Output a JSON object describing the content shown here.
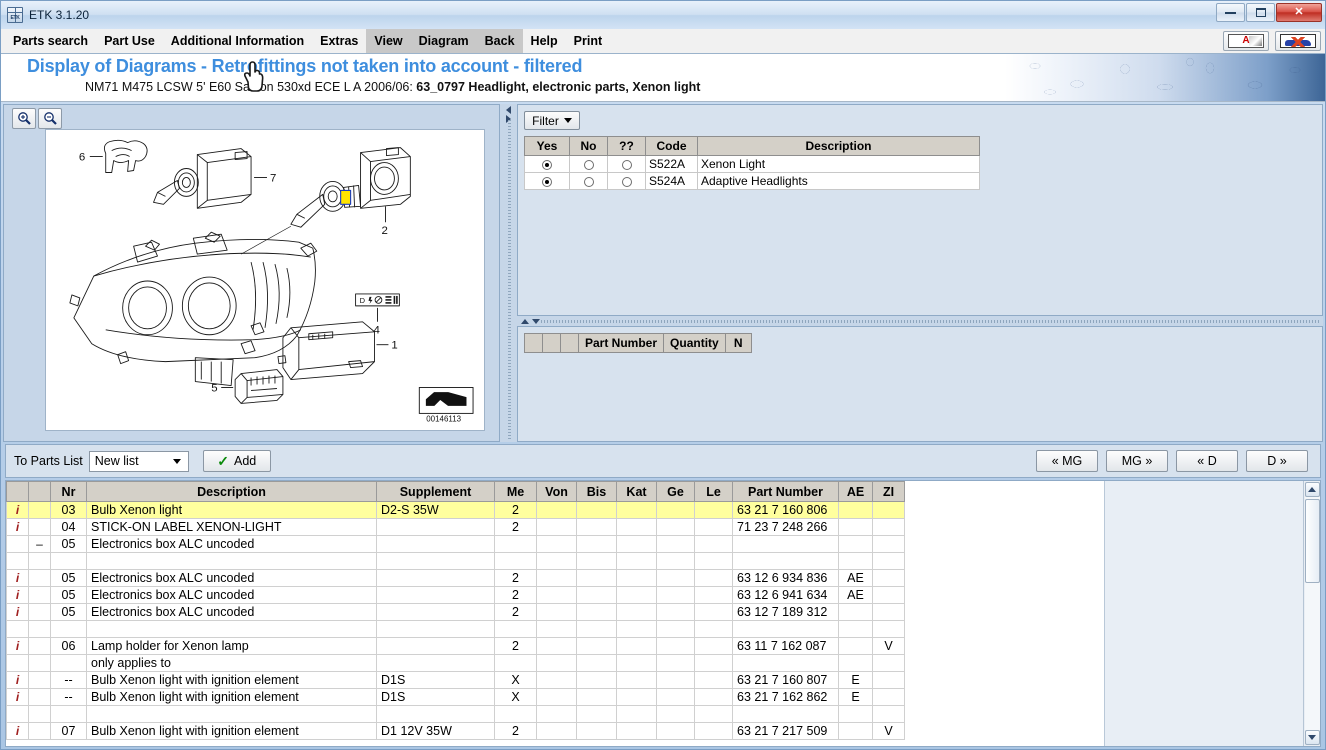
{
  "window": {
    "title": "ETK 3.1.20",
    "icon": "etk-app-icon",
    "minimize_label": "Minimize",
    "maximize_label": "Maximize",
    "close_label": "✕"
  },
  "menubar": {
    "items": [
      {
        "label": "Parts search",
        "highlighted": false
      },
      {
        "label": "Part Use",
        "highlighted": false
      },
      {
        "label": "Additional Information",
        "highlighted": false
      },
      {
        "label": "Extras",
        "highlighted": false
      },
      {
        "label": "View",
        "highlighted": true
      },
      {
        "label": "Diagram",
        "highlighted": true
      },
      {
        "label": "Back",
        "highlighted": true
      },
      {
        "label": "Help",
        "highlighted": false
      },
      {
        "label": "Print",
        "highlighted": false
      }
    ],
    "tools": [
      {
        "name": "alphabet-index-icon",
        "glyph": "A"
      },
      {
        "name": "vehicle-icon",
        "glyph": "car"
      }
    ]
  },
  "banner": {
    "title": "Display of Diagrams - Retrofittings not taken into account - filtered",
    "subtitle_prefix": "NM71 M475 LCSW 5' E60 Saloon 530xd ECE L A 2006/06: ",
    "subtitle_bold": "63_0797 Headlight, electronic parts, Xenon light",
    "title_color": "#3e8ede"
  },
  "diagram": {
    "zoom_in_label": "Zoom in",
    "zoom_out_label": "Zoom out",
    "image_id": "00146113",
    "callouts": [
      "1",
      "2",
      "4",
      "5",
      "6",
      "7"
    ],
    "label_icon_text": "D"
  },
  "filter": {
    "button_label": "Filter",
    "columns": [
      "Yes",
      "No",
      "??",
      "Code",
      "Description"
    ],
    "rows": [
      {
        "yes": true,
        "no": false,
        "unknown": false,
        "code": "S522A",
        "description": "Xenon Light"
      },
      {
        "yes": true,
        "no": false,
        "unknown": false,
        "code": "S524A",
        "description": "Adaptive Headlights"
      }
    ]
  },
  "selected_parts": {
    "columns": [
      "",
      "",
      "",
      "Part Number",
      "Quantity",
      "N"
    ],
    "rows": []
  },
  "actionbar": {
    "to_parts_list_label": "To Parts List",
    "list_value": "New list",
    "add_label": "Add",
    "nav": [
      {
        "label": "« MG",
        "name": "prev-main-group-button"
      },
      {
        "label": "MG »",
        "name": "next-main-group-button"
      },
      {
        "label": "« D",
        "name": "prev-diagram-button"
      },
      {
        "label": "D »",
        "name": "next-diagram-button"
      }
    ]
  },
  "parts_grid": {
    "columns": [
      "",
      "",
      "Nr",
      "Description",
      "Supplement",
      "Me",
      "Von",
      "Bis",
      "Kat",
      "Ge",
      "Le",
      "Part Number",
      "AE",
      "ZI"
    ],
    "rows": [
      {
        "info": "i",
        "exp": "",
        "nr": "03",
        "description": "Bulb Xenon light",
        "supplement": "D2-S 35W",
        "me": "2",
        "von": "",
        "bis": "",
        "kat": "",
        "ge": "",
        "le": "",
        "part_number": "63 21 7 160 806",
        "ae": "",
        "zi": "",
        "highlighted": true
      },
      {
        "info": "i",
        "exp": "",
        "nr": "04",
        "description": "STICK-ON LABEL XENON-LIGHT",
        "supplement": "",
        "me": "2",
        "von": "",
        "bis": "",
        "kat": "",
        "ge": "",
        "le": "",
        "part_number": "71 23 7 248 266",
        "ae": "",
        "zi": "",
        "highlighted": false
      },
      {
        "info": "",
        "exp": "–",
        "nr": "05",
        "description": "Electronics box ALC uncoded",
        "supplement": "",
        "me": "",
        "von": "",
        "bis": "",
        "kat": "",
        "ge": "",
        "le": "",
        "part_number": "",
        "ae": "",
        "zi": "",
        "highlighted": false
      },
      {
        "info": "",
        "exp": "",
        "nr": "",
        "description": "",
        "supplement": "",
        "me": "",
        "von": "",
        "bis": "",
        "kat": "",
        "ge": "",
        "le": "",
        "part_number": "",
        "ae": "",
        "zi": "",
        "highlighted": false
      },
      {
        "info": "i",
        "exp": "",
        "nr": "05",
        "description": "Electronics box ALC uncoded",
        "supplement": "",
        "me": "2",
        "von": "",
        "bis": "",
        "kat": "",
        "ge": "",
        "le": "",
        "part_number": "63 12 6 934 836",
        "ae": "AE",
        "zi": "",
        "highlighted": false
      },
      {
        "info": "i",
        "exp": "",
        "nr": "05",
        "description": "Electronics box ALC uncoded",
        "supplement": "",
        "me": "2",
        "von": "",
        "bis": "",
        "kat": "",
        "ge": "",
        "le": "",
        "part_number": "63 12 6 941 634",
        "ae": "AE",
        "zi": "",
        "highlighted": false
      },
      {
        "info": "i",
        "exp": "",
        "nr": "05",
        "description": "Electronics box ALC uncoded",
        "supplement": "",
        "me": "2",
        "von": "",
        "bis": "",
        "kat": "",
        "ge": "",
        "le": "",
        "part_number": "63 12 7 189 312",
        "ae": "",
        "zi": "",
        "highlighted": false
      },
      {
        "info": "",
        "exp": "",
        "nr": "",
        "description": "",
        "supplement": "",
        "me": "",
        "von": "",
        "bis": "",
        "kat": "",
        "ge": "",
        "le": "",
        "part_number": "",
        "ae": "",
        "zi": "",
        "highlighted": false
      },
      {
        "info": "i",
        "exp": "",
        "nr": "06",
        "description": "Lamp holder for Xenon lamp",
        "supplement": "",
        "me": "2",
        "von": "",
        "bis": "",
        "kat": "",
        "ge": "",
        "le": "",
        "part_number": "63 11 7 162 087",
        "ae": "",
        "zi": "V",
        "highlighted": false
      },
      {
        "info": "",
        "exp": "",
        "nr": "",
        "description": "only applies to",
        "supplement": "",
        "me": "",
        "von": "",
        "bis": "",
        "kat": "",
        "ge": "",
        "le": "",
        "part_number": "",
        "ae": "",
        "zi": "",
        "highlighted": false
      },
      {
        "info": "i",
        "exp": "",
        "nr": "--",
        "description": "Bulb Xenon light with ignition element",
        "supplement": "D1S",
        "me": "X",
        "von": "",
        "bis": "",
        "kat": "",
        "ge": "",
        "le": "",
        "part_number": "63 21 7 160 807",
        "ae": "E",
        "zi": "",
        "highlighted": false
      },
      {
        "info": "i",
        "exp": "",
        "nr": "--",
        "description": "Bulb Xenon light with ignition element",
        "supplement": "D1S",
        "me": "X",
        "von": "",
        "bis": "",
        "kat": "",
        "ge": "",
        "le": "",
        "part_number": "63 21 7 162 862",
        "ae": "E",
        "zi": "",
        "highlighted": false
      },
      {
        "info": "",
        "exp": "",
        "nr": "",
        "description": "",
        "supplement": "",
        "me": "",
        "von": "",
        "bis": "",
        "kat": "",
        "ge": "",
        "le": "",
        "part_number": "",
        "ae": "",
        "zi": "",
        "highlighted": false
      },
      {
        "info": "i",
        "exp": "",
        "nr": "07",
        "description": "Bulb Xenon light with ignition element",
        "supplement": "D1 12V 35W",
        "me": "2",
        "von": "",
        "bis": "",
        "kat": "",
        "ge": "",
        "le": "",
        "part_number": "63 21 7 217 509",
        "ae": "",
        "zi": "V",
        "highlighted": false
      }
    ]
  }
}
